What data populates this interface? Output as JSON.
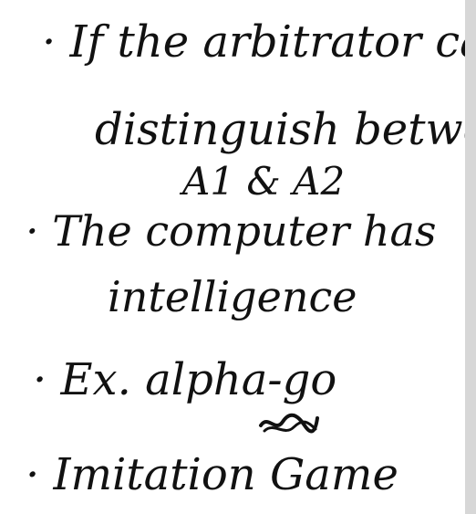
{
  "notes": {
    "lines": [
      "· If the arbitrator can't",
      "distinguish between",
      "A1 & A2",
      "· The computer has",
      "intelligence",
      "· Ex. alpha-go",
      "· Imitation Game"
    ]
  }
}
